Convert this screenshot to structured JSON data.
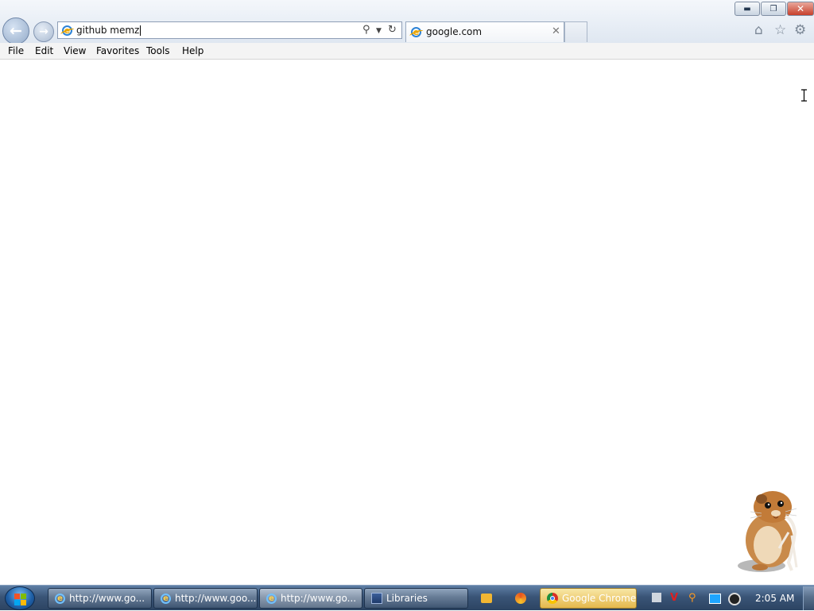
{
  "browser": {
    "address_value": "github memz",
    "tab_title": "google.com",
    "menu": [
      "File",
      "Edit",
      "View",
      "Favorites",
      "Tools",
      "Help"
    ]
  },
  "taskbar": {
    "items": [
      {
        "label": "http://www.go..."
      },
      {
        "label": "http://www.goo..."
      },
      {
        "label": "http://www.go..."
      },
      {
        "label": "Libraries"
      },
      {
        "label": "Google Chrome"
      }
    ],
    "clock": "2:05 AM"
  },
  "icons": {
    "back": "back-arrow-icon",
    "forward": "forward-arrow-icon",
    "search": "search-icon",
    "refresh": "refresh-icon",
    "home": "home-icon",
    "favorites": "star-icon",
    "tools": "gear-icon",
    "overlay": "hamster-image"
  },
  "colors": {
    "taskbar": "#3a5577",
    "close_button": "#c7402b",
    "active_task": "#e5b84c",
    "page_bg": "#ffffff"
  }
}
